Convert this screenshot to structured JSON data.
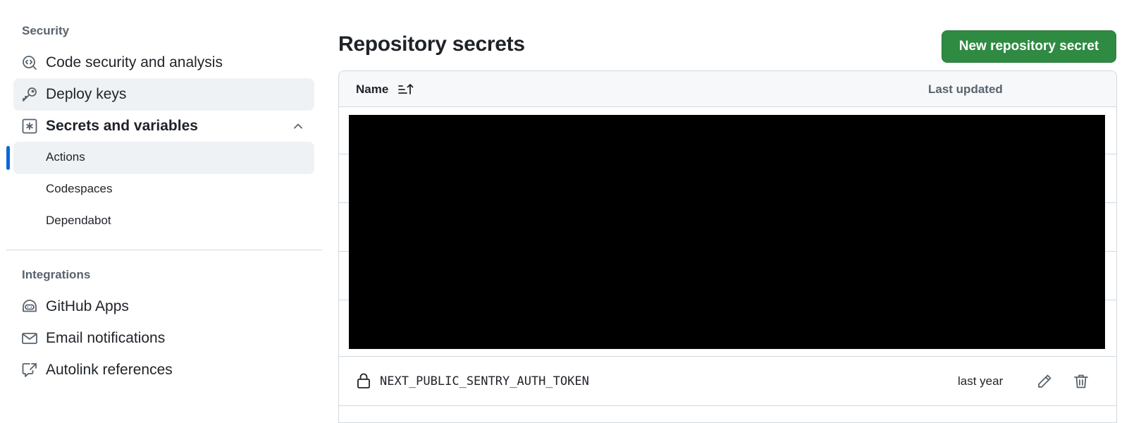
{
  "sidebar": {
    "security_heading": "Security",
    "items": [
      {
        "label": "Code security and analysis",
        "icon": "codescan-icon"
      },
      {
        "label": "Deploy keys",
        "icon": "key-icon"
      },
      {
        "label": "Secrets and variables",
        "icon": "key-asterisk-icon"
      }
    ],
    "sub_items": [
      {
        "label": "Actions"
      },
      {
        "label": "Codespaces"
      },
      {
        "label": "Dependabot"
      }
    ],
    "integrations_heading": "Integrations",
    "integrations": [
      {
        "label": "GitHub Apps",
        "icon": "hubot-icon"
      },
      {
        "label": "Email notifications",
        "icon": "mail-icon"
      },
      {
        "label": "Autolink references",
        "icon": "cross-reference-icon"
      }
    ]
  },
  "main": {
    "title": "Repository secrets",
    "new_button": "New repository secret",
    "table": {
      "col_name": "Name",
      "col_updated": "Last updated",
      "rows": [
        {
          "name": "NEXT_PUBLIC_SENTRY_AUTH_TOKEN",
          "updated": "last year"
        }
      ]
    }
  },
  "colors": {
    "accent": "#0969da",
    "primary_button": "#2f8a42",
    "active_bg": "#eff2f5"
  }
}
